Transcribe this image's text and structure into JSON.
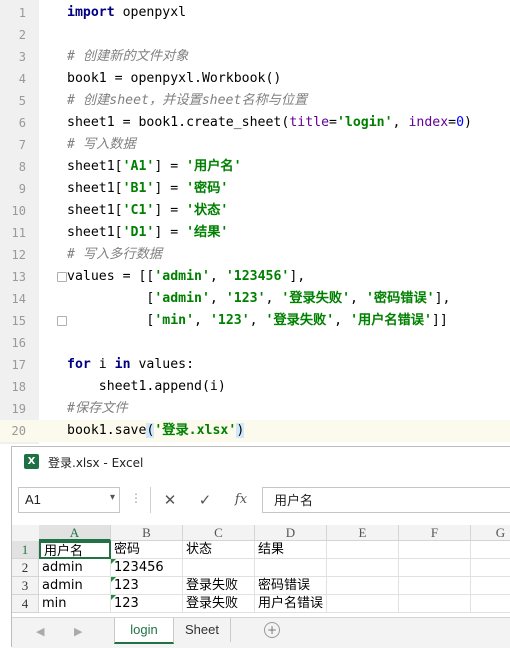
{
  "editor": {
    "lines": [
      {
        "n": "1",
        "tokens": [
          {
            "t": "import",
            "c": "kw"
          },
          {
            "t": " openpyxl",
            "c": ""
          }
        ]
      },
      {
        "n": "2",
        "tokens": []
      },
      {
        "n": "3",
        "tokens": [
          {
            "t": "# 创建新的文件对象",
            "c": "com"
          }
        ]
      },
      {
        "n": "4",
        "tokens": [
          {
            "t": "book1 = openpyxl.Workbook()",
            "c": ""
          }
        ]
      },
      {
        "n": "5",
        "tokens": [
          {
            "t": "# 创建sheet，并设置sheet名称与位置",
            "c": "com"
          }
        ]
      },
      {
        "n": "6",
        "tokens": [
          {
            "t": "sheet1 = book1.create_sheet(",
            "c": ""
          },
          {
            "t": "title",
            "c": "kwarg"
          },
          {
            "t": "=",
            "c": ""
          },
          {
            "t": "'login'",
            "c": "str"
          },
          {
            "t": ", ",
            "c": ""
          },
          {
            "t": "index",
            "c": "kwarg"
          },
          {
            "t": "=",
            "c": ""
          },
          {
            "t": "0",
            "c": "num"
          },
          {
            "t": ")",
            "c": ""
          }
        ]
      },
      {
        "n": "7",
        "tokens": [
          {
            "t": "# 写入数据",
            "c": "com"
          }
        ]
      },
      {
        "n": "8",
        "tokens": [
          {
            "t": "sheet1[",
            "c": ""
          },
          {
            "t": "'A1'",
            "c": "str"
          },
          {
            "t": "] = ",
            "c": ""
          },
          {
            "t": "'用户名'",
            "c": "str"
          }
        ]
      },
      {
        "n": "9",
        "tokens": [
          {
            "t": "sheet1[",
            "c": ""
          },
          {
            "t": "'B1'",
            "c": "str"
          },
          {
            "t": "] = ",
            "c": ""
          },
          {
            "t": "'密码'",
            "c": "str"
          }
        ]
      },
      {
        "n": "10",
        "tokens": [
          {
            "t": "sheet1[",
            "c": ""
          },
          {
            "t": "'C1'",
            "c": "str"
          },
          {
            "t": "] = ",
            "c": ""
          },
          {
            "t": "'状态'",
            "c": "str"
          }
        ]
      },
      {
        "n": "11",
        "tokens": [
          {
            "t": "sheet1[",
            "c": ""
          },
          {
            "t": "'D1'",
            "c": "str"
          },
          {
            "t": "] = ",
            "c": ""
          },
          {
            "t": "'结果'",
            "c": "str"
          }
        ]
      },
      {
        "n": "12",
        "tokens": [
          {
            "t": "# 写入多行数据",
            "c": "com"
          }
        ]
      },
      {
        "n": "13",
        "tokens": [
          {
            "t": "values = [[",
            "c": ""
          },
          {
            "t": "'admin'",
            "c": "str"
          },
          {
            "t": ", ",
            "c": ""
          },
          {
            "t": "'123456'",
            "c": "str"
          },
          {
            "t": "],",
            "c": ""
          }
        ]
      },
      {
        "n": "14",
        "tokens": [
          {
            "t": "          [",
            "c": ""
          },
          {
            "t": "'admin'",
            "c": "str"
          },
          {
            "t": ", ",
            "c": ""
          },
          {
            "t": "'123'",
            "c": "str"
          },
          {
            "t": ", ",
            "c": ""
          },
          {
            "t": "'登录失败'",
            "c": "str"
          },
          {
            "t": ", ",
            "c": ""
          },
          {
            "t": "'密码错误'",
            "c": "str"
          },
          {
            "t": "],",
            "c": ""
          }
        ]
      },
      {
        "n": "15",
        "tokens": [
          {
            "t": "          [",
            "c": ""
          },
          {
            "t": "'min'",
            "c": "str"
          },
          {
            "t": ", ",
            "c": ""
          },
          {
            "t": "'123'",
            "c": "str"
          },
          {
            "t": ", ",
            "c": ""
          },
          {
            "t": "'登录失败'",
            "c": "str"
          },
          {
            "t": ", ",
            "c": ""
          },
          {
            "t": "'用户名错误'",
            "c": "str"
          },
          {
            "t": "]]",
            "c": ""
          }
        ]
      },
      {
        "n": "16",
        "tokens": []
      },
      {
        "n": "17",
        "tokens": [
          {
            "t": "for",
            "c": "kw"
          },
          {
            "t": " i ",
            "c": ""
          },
          {
            "t": "in",
            "c": "kw"
          },
          {
            "t": " values:",
            "c": ""
          }
        ]
      },
      {
        "n": "18",
        "tokens": [
          {
            "t": "    sheet1.append(i)",
            "c": ""
          }
        ]
      },
      {
        "n": "19",
        "tokens": [
          {
            "t": "#保存文件",
            "c": "com"
          }
        ]
      },
      {
        "n": "20",
        "tokens": [
          {
            "t": "book1.save",
            "c": ""
          },
          {
            "t": "(",
            "c": "paren-hl"
          },
          {
            "t": "'登录.xlsx'",
            "c": "str"
          },
          {
            "t": ")",
            "c": "paren-hl"
          }
        ]
      }
    ],
    "current_line": "20"
  },
  "excel": {
    "title": "登录.xlsx - Excel",
    "logo": "X",
    "name_box": "A1",
    "formula_value": "用户名",
    "columns": [
      "A",
      "B",
      "C",
      "D",
      "E",
      "F",
      "G"
    ],
    "rows": [
      {
        "n": "1",
        "cells": [
          "用户名",
          "密码",
          "状态",
          "结果"
        ]
      },
      {
        "n": "2",
        "cells": [
          "admin",
          "123456",
          "",
          ""
        ]
      },
      {
        "n": "3",
        "cells": [
          "admin",
          "123",
          "登录失败",
          "密码错误"
        ]
      },
      {
        "n": "4",
        "cells": [
          "min",
          "123",
          "登录失败",
          "用户名错误"
        ]
      }
    ],
    "text_number_flags": [
      "2:B",
      "3:B",
      "4:B"
    ],
    "sheets": [
      "login",
      "Sheet"
    ],
    "active_sheet": "login",
    "accent": "#217346"
  }
}
